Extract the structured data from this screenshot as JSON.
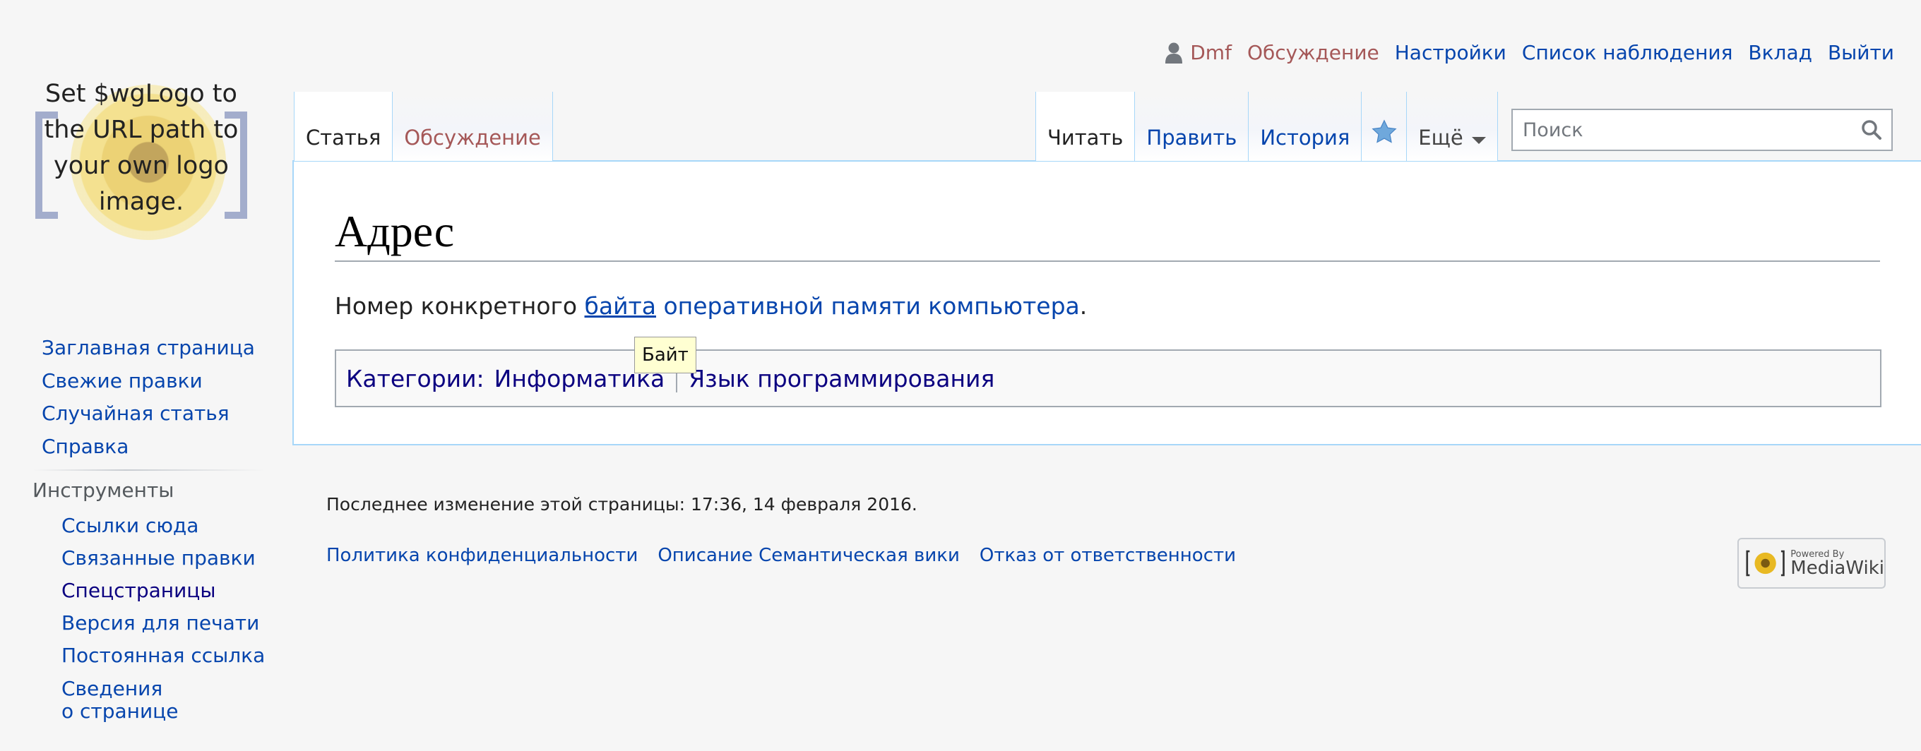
{
  "personal": {
    "username": "Dmf",
    "talk": "Обсуждение",
    "preferences": "Настройки",
    "watchlist": "Список наблюдения",
    "contributions": "Вклад",
    "logout": "Выйти"
  },
  "logo": {
    "text": "Set $wgLogo to the URL path to your own logo image."
  },
  "sidebar": {
    "navigation": [
      {
        "label": "Заглавная страница"
      },
      {
        "label": "Свежие правки"
      },
      {
        "label": "Случайная статья"
      },
      {
        "label": "Справка"
      }
    ],
    "tools_heading": "Инструменты",
    "tools": [
      {
        "label": "Ссылки сюда"
      },
      {
        "label": "Связанные правки"
      },
      {
        "label": "Спецстраницы"
      },
      {
        "label": "Версия для печати"
      },
      {
        "label": "Постоянная ссылка"
      },
      {
        "label_line1": "Сведения",
        "label_line2": "о странице"
      }
    ]
  },
  "tabs": {
    "article": "Статья",
    "discussion": "Обсуждение",
    "read": "Читать",
    "edit": "Править",
    "history": "История",
    "more": "Ещё"
  },
  "search": {
    "placeholder": "Поиск"
  },
  "article": {
    "title": "Адрес",
    "text_before": "Номер конкретного ",
    "link_hovered": "байта",
    "text_link2": " оперативной памяти компьютера",
    "text_after": ".",
    "tooltip": "Байт",
    "categories_label": "Категории",
    "categories_colon": ":",
    "categories": [
      "Информатика",
      "Язык программирования"
    ]
  },
  "footer": {
    "last_modified": "Последнее изменение этой страницы: 17:36, 14 февраля 2016.",
    "privacy": "Политика конфиденциальности",
    "about": "Описание Семантическая вики",
    "disclaimer": "Отказ от ответственности",
    "powered_small": "Powered By",
    "powered_big": "MediaWiki"
  },
  "colors": {
    "link": "#0645ad",
    "visited": "#0b0080",
    "new_link": "#a55858",
    "border_blue": "#a7d7f9",
    "background": "#f6f6f6"
  }
}
